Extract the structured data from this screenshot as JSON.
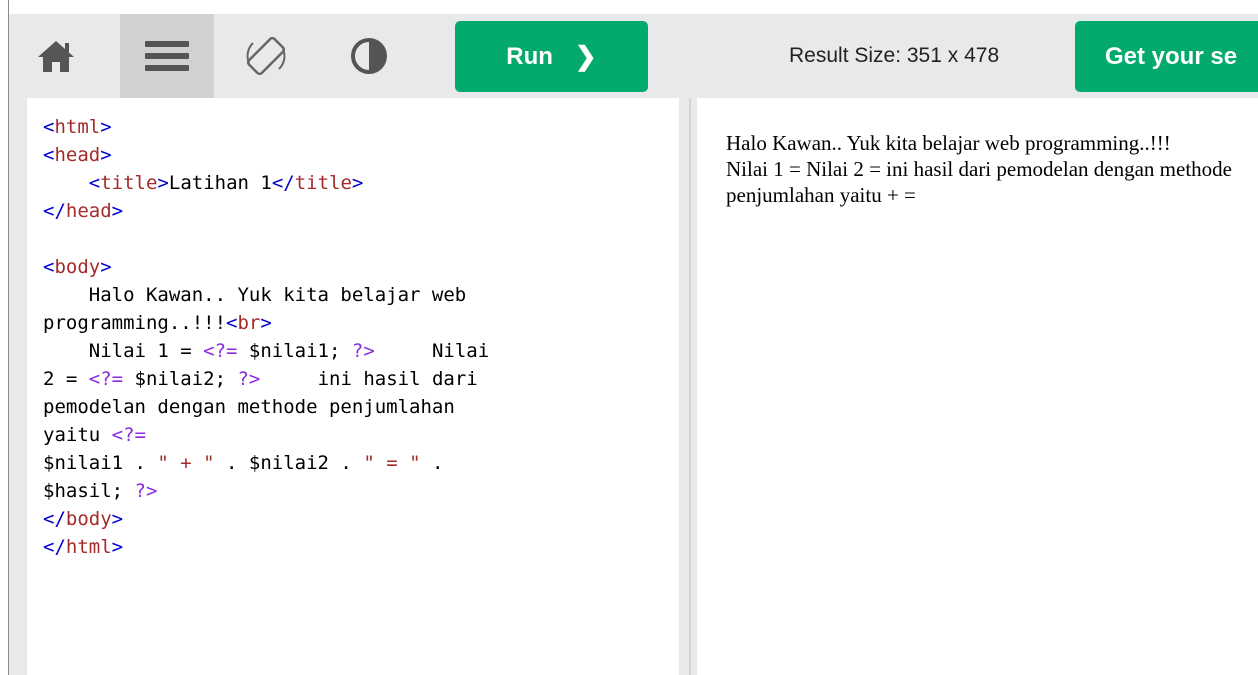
{
  "toolbar": {
    "home_icon": "home-icon",
    "menu_icon": "hamburger-menu-icon",
    "rotate_icon": "rotate-orientation-icon",
    "theme_icon": "contrast-theme-icon",
    "run_label": "Run",
    "run_chevron": "❯",
    "result_size_label": "Result Size: 351 x 478",
    "get_label": "Get your se"
  },
  "editor": {
    "lines": [
      "<html>",
      "<head>",
      "    <title>Latihan 1</title>",
      "</head>",
      "",
      "<body>",
      "    Halo Kawan.. Yuk kita belajar web",
      "programming..!!!<br>",
      "    Nilai 1 = <?= $nilai1; ?>     Nilai",
      "2 = <?= $nilai2; ?>     ini hasil dari",
      "pemodelan dengan methode penjumlahan",
      "yaitu <?=",
      "$nilai1 . \" + \" . $nilai2 . \" = \" .",
      "$hasil; ?>",
      "</body>",
      "</html>"
    ]
  },
  "result": {
    "line1": "Halo Kawan.. Yuk kita belajar web programming..!!!",
    "line2": "Nilai 1 = Nilai 2 = ini hasil dari pemodelan dengan methode penjumlahan yaitu + ="
  },
  "colors": {
    "accent": "#04aa6d",
    "toolbar_bg": "#e7e9eb",
    "tag": "#0000cd",
    "tag_name": "#a52a2a",
    "php": "#8a2be2"
  }
}
